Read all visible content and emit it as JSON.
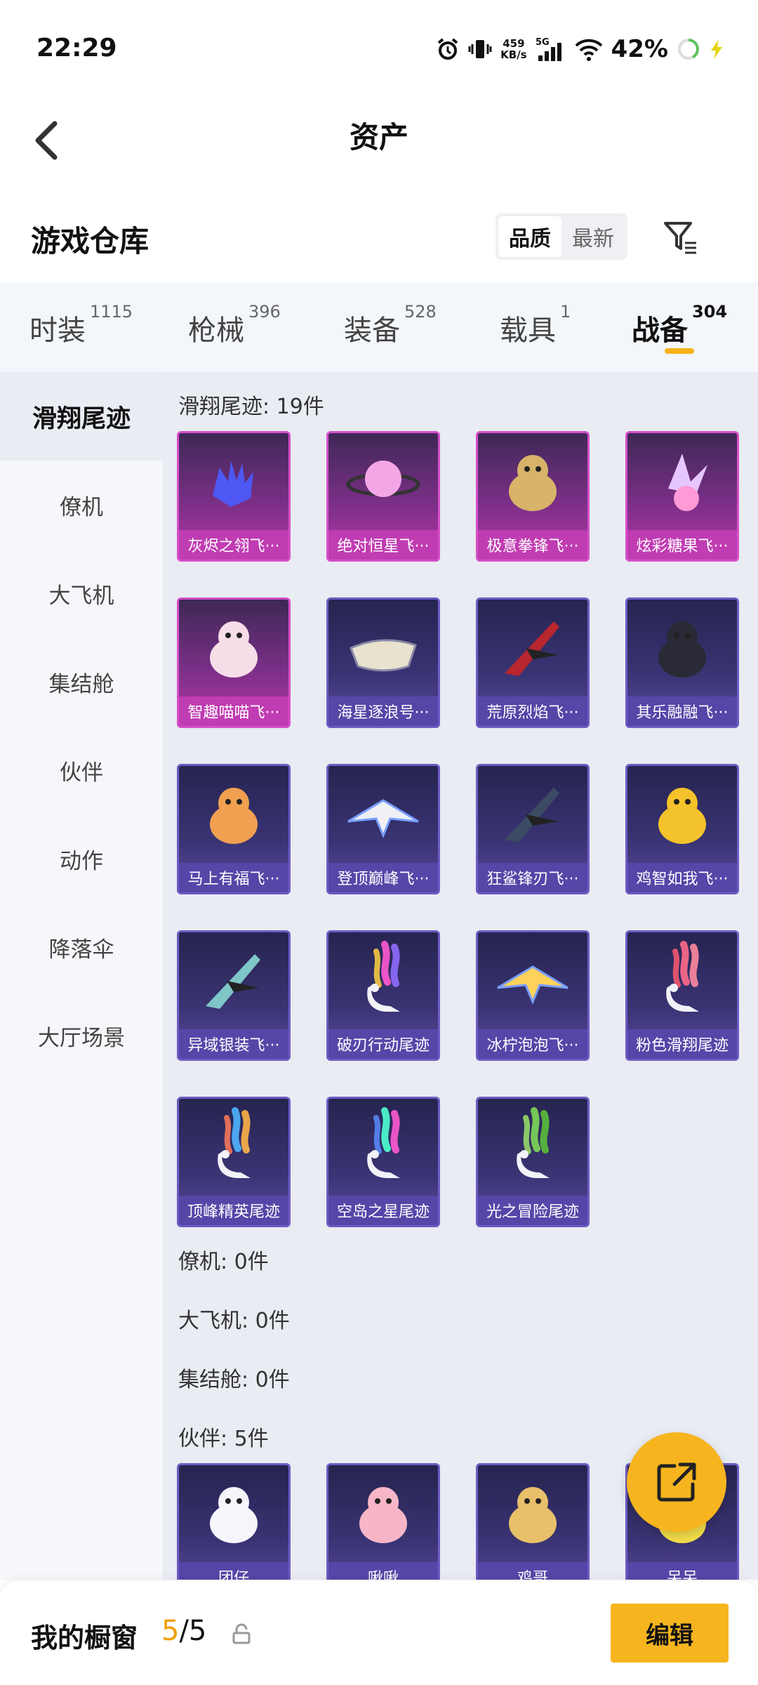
{
  "status_bar": {
    "time": "22:29",
    "net_speed_value": "459",
    "net_speed_unit": "KB/s",
    "network": "5G",
    "battery": "42%"
  },
  "header": {
    "title": "资产"
  },
  "section": {
    "title": "游戏仓库",
    "sort_options": [
      "品质",
      "最新"
    ],
    "sort_selected": "品质"
  },
  "tabs": [
    {
      "label": "时装",
      "count": "1115"
    },
    {
      "label": "枪械",
      "count": "396"
    },
    {
      "label": "装备",
      "count": "528"
    },
    {
      "label": "载具",
      "count": "1"
    },
    {
      "label": "战备",
      "count": "304",
      "active": true
    }
  ],
  "sidebar": {
    "items": [
      "滑翔尾迹",
      "僚机",
      "大飞机",
      "集结舱",
      "伙伴",
      "动作",
      "降落伞",
      "大厅场景"
    ],
    "active": "滑翔尾迹"
  },
  "groups": {
    "glide_label": "滑翔尾迹: 19件",
    "wingman_label": "僚机: 0件",
    "bigplane_label": "大飞机: 0件",
    "assembly_label": "集结舱: 0件",
    "partner_label": "伙伴: 5件"
  },
  "glide_items": [
    {
      "name": "灰烬之翎飞···",
      "tier": "pink",
      "icon": "blue-glove-icon"
    },
    {
      "name": "绝对恒星飞···",
      "tier": "pink",
      "icon": "pink-planet-icon"
    },
    {
      "name": "极意拳锋飞···",
      "tier": "pink",
      "icon": "boxing-elephant-icon"
    },
    {
      "name": "炫彩糖果飞···",
      "tier": "pink",
      "icon": "crystal-candy-icon"
    },
    {
      "name": "智趣喵喵飞···",
      "tier": "pink",
      "icon": "cat-pod-icon"
    },
    {
      "name": "海星逐浪号···",
      "tier": "purple",
      "icon": "boat-icon"
    },
    {
      "name": "荒原烈焰飞···",
      "tier": "purple",
      "icon": "flame-jet-icon"
    },
    {
      "name": "其乐融融飞···",
      "tier": "purple",
      "icon": "penguin-icon"
    },
    {
      "name": "马上有福飞···",
      "tier": "purple",
      "icon": "toy-horse-icon"
    },
    {
      "name": "登顶巅峰飞···",
      "tier": "purple",
      "icon": "white-jet-icon"
    },
    {
      "name": "狂鲨锋刃飞···",
      "tier": "purple",
      "icon": "shark-jet-icon"
    },
    {
      "name": "鸡智如我飞···",
      "tier": "purple",
      "icon": "chicken-icon"
    },
    {
      "name": "异域银装飞···",
      "tier": "purple",
      "icon": "silver-wing-icon"
    },
    {
      "name": "破刃行动尾迹",
      "tier": "purple",
      "icon": "rainbow-trail-icon"
    },
    {
      "name": "冰柠泡泡飞···",
      "tier": "purple",
      "icon": "paper-plane-icon"
    },
    {
      "name": "粉色滑翔尾迹",
      "tier": "purple",
      "icon": "pink-trail-icon"
    },
    {
      "name": "顶峰精英尾迹",
      "tier": "purple",
      "icon": "blue-orange-trail-icon"
    },
    {
      "name": "空岛之星尾迹",
      "tier": "purple",
      "icon": "star-trail-icon"
    },
    {
      "name": "光之冒险尾迹",
      "tier": "purple",
      "icon": "green-trail-icon"
    }
  ],
  "partner_items": [
    {
      "name": "团仔",
      "tier": "purple",
      "icon": "snowman-goggles-icon"
    },
    {
      "name": "啾啾",
      "tier": "purple",
      "icon": "pink-bird-icon"
    },
    {
      "name": "鸡哥",
      "tier": "purple",
      "icon": "sunglasses-chicken-icon"
    },
    {
      "name": "呆呆",
      "tier": "purple",
      "icon": "yellow-duck-icon"
    }
  ],
  "bottom_bar": {
    "label": "我的橱窗",
    "count_current": "5",
    "count_total": "/5",
    "edit": "编辑"
  },
  "colors": {
    "accent": "#f6b51f",
    "pink_tier": "#c03cb2",
    "purple_tier": "#5646a8"
  }
}
